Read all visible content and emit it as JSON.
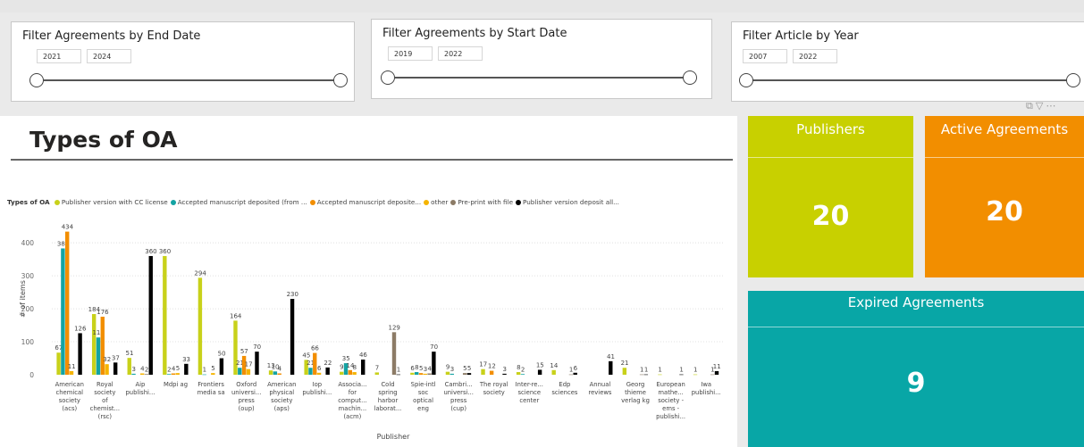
{
  "filters": [
    {
      "title": "Filter Agreements by End Date",
      "from": "2021",
      "to": "2024"
    },
    {
      "title": "Filter Agreements by Start Date",
      "from": "2019",
      "to": "2022"
    },
    {
      "title": "Filter Article by Year",
      "from": "2007",
      "to": "2022"
    }
  ],
  "visual_icons": {
    "focus": "focus-icon",
    "filter": "filter-icon",
    "more": "more-icon"
  },
  "main_title": "Types of OA",
  "legend": {
    "title": "Types of OA",
    "items": [
      {
        "label": "Publisher version with CC license",
        "color": "#c8d11a"
      },
      {
        "label": "Accepted manuscript deposited (from ...",
        "color": "#13a3a3"
      },
      {
        "label": "Accepted manuscript deposite...",
        "color": "#f28e00"
      },
      {
        "label": "other",
        "color": "#f5b400"
      },
      {
        "label": "Pre-print with file",
        "color": "#8c7b66"
      },
      {
        "label": "Publisher version deposit all...",
        "color": "#000000"
      }
    ]
  },
  "chart_data": {
    "type": "bar",
    "xlabel": "Publisher",
    "ylabel": "# of items",
    "ylim": [
      0,
      460
    ],
    "yticks": [
      0,
      100,
      200,
      300,
      400
    ],
    "categories": [
      [
        "American",
        "chemical",
        "society",
        "(acs)"
      ],
      [
        "Royal",
        "society",
        "of",
        "chemist...",
        "(rsc)"
      ],
      [
        "Aip",
        "publishi..."
      ],
      [
        "Mdpi ag"
      ],
      [
        "Frontiers",
        "media sa"
      ],
      [
        "Oxford",
        "universi...",
        "press",
        "(oup)"
      ],
      [
        "American",
        "physical",
        "society",
        "(aps)"
      ],
      [
        "Iop",
        "publishi..."
      ],
      [
        "Associa...",
        "for",
        "comput...",
        "machin...",
        "(acm)"
      ],
      [
        "Cold",
        "spring",
        "harbor",
        "laborat..."
      ],
      [
        "Spie-intl",
        "soc",
        "optical",
        "eng"
      ],
      [
        "Cambri...",
        "universi...",
        "press",
        "(cup)"
      ],
      [
        "The royal",
        "society"
      ],
      [
        "Inter-re...",
        "science",
        "center"
      ],
      [
        "Edp",
        "sciences"
      ],
      [
        "Annual",
        "reviews"
      ],
      [
        "Georg",
        "thieme",
        "verlag kg"
      ],
      [
        "European",
        "mathe...",
        "society -",
        "ems -",
        "publishi..."
      ],
      [
        "Iwa",
        "publishi..."
      ]
    ],
    "series": [
      {
        "name": "Publisher version with CC license",
        "color": "#c8d11a",
        "values": [
          67,
          184,
          51,
          360,
          294,
          164,
          13,
          45,
          9,
          7,
          6,
          9,
          17,
          8,
          14,
          0,
          21,
          1,
          1
        ]
      },
      {
        "name": "Accepted manuscript deposited (from ...",
        "color": "#13a3a3",
        "values": [
          383,
          113,
          3,
          2,
          1,
          21,
          10,
          21,
          35,
          0,
          8,
          3,
          0,
          2,
          0,
          0,
          0,
          0,
          0
        ]
      },
      {
        "name": "Accepted manuscript deposite...",
        "color": "#f28e00",
        "values": [
          434,
          176,
          0,
          4,
          0,
          57,
          4,
          66,
          14,
          0,
          5,
          0,
          12,
          0,
          0,
          0,
          0,
          0,
          0
        ]
      },
      {
        "name": "other",
        "color": "#f5b400",
        "values": [
          11,
          32,
          4,
          5,
          5,
          17,
          0,
          6,
          8,
          0,
          3,
          0,
          0,
          0,
          0,
          0,
          0,
          0,
          0
        ]
      },
      {
        "name": "Pre-print with file",
        "color": "#8c7b66",
        "values": [
          0,
          0,
          2,
          0,
          0,
          0,
          0,
          0,
          0,
          129,
          4,
          5,
          0,
          0,
          1,
          0,
          1,
          0,
          1
        ]
      },
      {
        "name": "Publisher version deposit all...",
        "color": "#000000",
        "values": [
          126,
          37,
          360,
          33,
          50,
          70,
          230,
          22,
          46,
          1,
          70,
          5,
          3,
          15,
          6,
          41,
          1,
          1,
          11
        ]
      }
    ]
  },
  "cards": {
    "publishers": {
      "label": "Publishers",
      "value": "20",
      "color": "#c8d000"
    },
    "active": {
      "label": "Active Agreements",
      "value": "20",
      "color": "#f28e00"
    },
    "expired": {
      "label": "Expired Agreements",
      "value": "9",
      "color": "#08a6a6"
    }
  }
}
